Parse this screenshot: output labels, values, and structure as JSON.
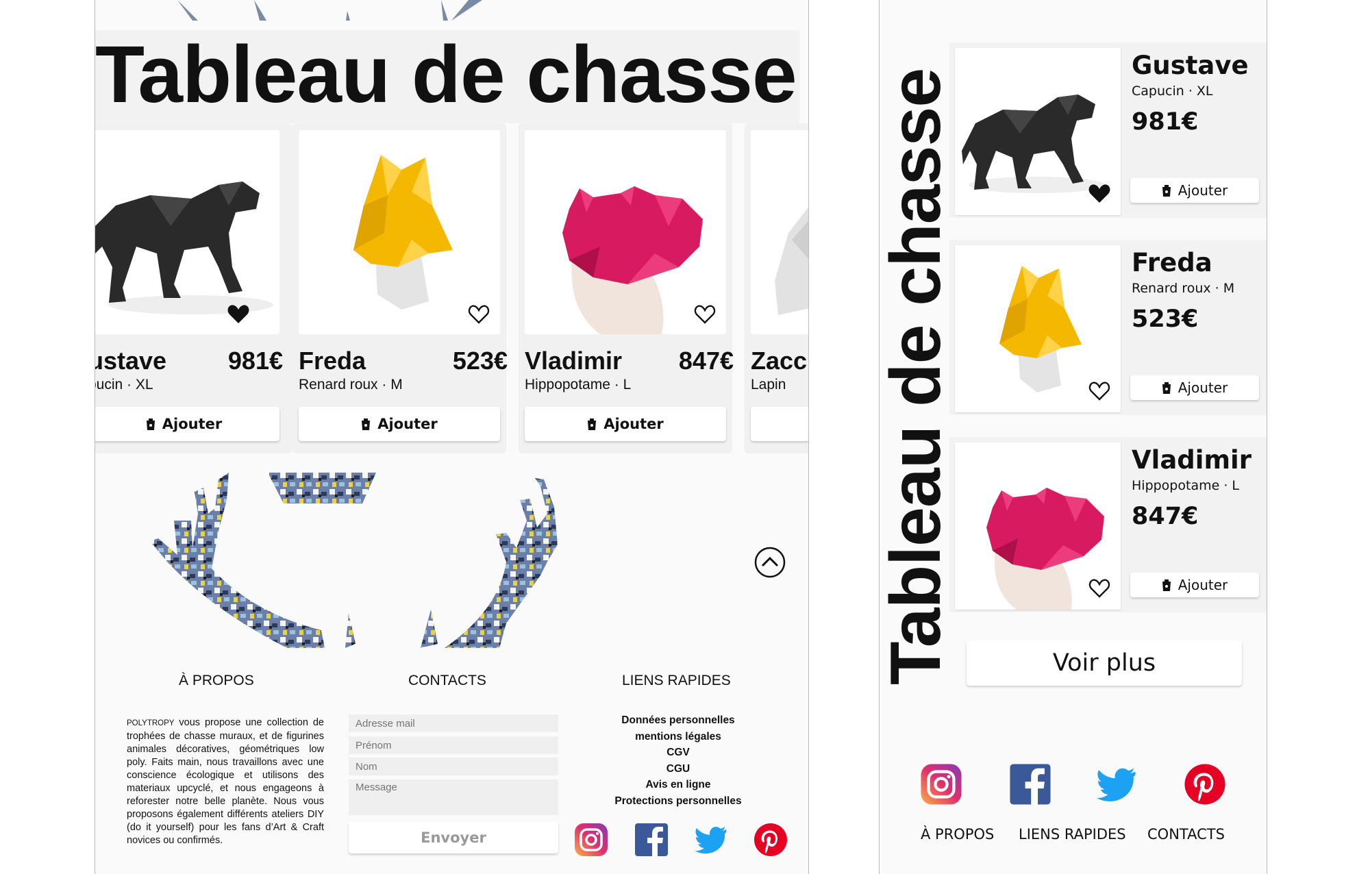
{
  "colors": {
    "accent_pink": "#d81b60",
    "accent_yellow": "#f5b800",
    "twitter_blue": "#1da1f2",
    "facebook_blue": "#3b5998",
    "pinterest_red": "#e60023"
  },
  "desktop": {
    "title": "Tableau de chasse",
    "products": [
      {
        "name": "ustave",
        "sub": "pucin · XL",
        "price": "981€",
        "button": "Ajouter",
        "favorite": true,
        "image": "black-monkey"
      },
      {
        "name": "Freda",
        "sub": "Renard roux · M",
        "price": "523€",
        "button": "Ajouter",
        "favorite": false,
        "image": "yellow-fox"
      },
      {
        "name": "Vladimir",
        "sub": "Hippopotame · L",
        "price": "847€",
        "button": "Ajouter",
        "favorite": false,
        "image": "pink-hippo"
      },
      {
        "name": "Zacc",
        "sub": "Lapin",
        "price": "",
        "button": "",
        "favorite": false,
        "image": "white-rabbit"
      }
    ],
    "footer": {
      "about_heading": "À PROPOS",
      "contacts_heading": "CONTACTS",
      "links_heading": "LIENS RAPIDES",
      "about_brand": "POLYTROPY",
      "about_text": "vous propose une collection de trophées de chasse muraux, et de figurines animales décoratives, géométriques low poly. Faits main, nous travaillons avec une conscience écologique et utilisons des materiaux upcyclé, et nous engageons à reforester notre belle planète. Nous vous proposons également différents ateliers DIY (do it yourself) pour les fans d’Art & Craft novices ou confirmés.",
      "form": {
        "email_placeholder": "Adresse mail",
        "firstname_placeholder": "Prénom",
        "lastname_placeholder": "Nom",
        "message_placeholder": "Message",
        "submit_label": "Envoyer"
      },
      "links": [
        "Données personnelles",
        "mentions légales",
        "CGV",
        "CGU",
        "Avis en ligne",
        "Protections personnelles"
      ],
      "social": [
        "instagram-icon",
        "facebook-icon",
        "twitter-icon",
        "pinterest-icon"
      ]
    }
  },
  "mobile": {
    "title": "Tableau de chasse",
    "products": [
      {
        "name": "Gustave",
        "sub": "Capucin · XL",
        "price": "981€",
        "button": "Ajouter",
        "favorite": true,
        "image": "black-monkey"
      },
      {
        "name": "Freda",
        "sub": "Renard roux · M",
        "price": "523€",
        "button": "Ajouter",
        "favorite": false,
        "image": "yellow-fox"
      },
      {
        "name": "Vladimir",
        "sub": "Hippopotame · L",
        "price": "847€",
        "button": "Ajouter",
        "favorite": false,
        "image": "pink-hippo"
      }
    ],
    "more_label": "Voir plus",
    "nav": [
      "À PROPOS",
      "LIENS RAPIDES",
      "CONTACTS"
    ]
  }
}
